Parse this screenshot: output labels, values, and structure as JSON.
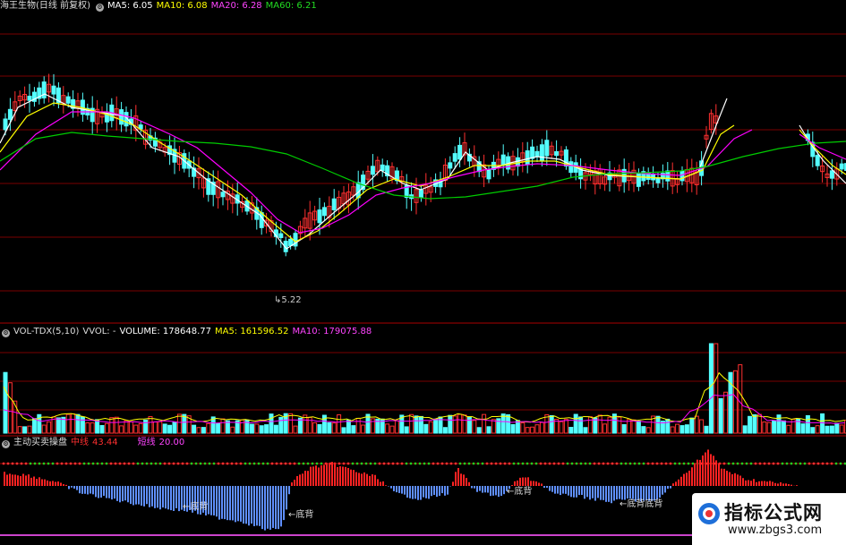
{
  "price_panel": {
    "name": "海王生物(日线 前复权)",
    "ma5": "MA5: 6.05",
    "ma10": "MA10: 6.08",
    "ma20": "MA20: 6.28",
    "ma60": "MA60: 6.21",
    "low_label": "5.22"
  },
  "volume_panel": {
    "indicator": "VOL-TDX(5,10)",
    "vvol": "VVOL: -",
    "volume": "VOLUME: 178648.77",
    "ma5": "MA5: 161596.52",
    "ma10": "MA10: 179075.88"
  },
  "oscillator_panel": {
    "name": "主动买卖操盘",
    "mid_label": "中线",
    "mid_value": "43.44",
    "short_label": "短线",
    "short_value": "20.00",
    "annotations": [
      "底背",
      "底背",
      "底背",
      "底背底背"
    ]
  },
  "watermark": {
    "title": "指标公式网",
    "url": "www.zbgs3.com"
  },
  "colors": {
    "up": "#ff3030",
    "down": "#54ffff",
    "ma5": "#ffffff",
    "ma10": "#ffff00",
    "ma20": "#ff00ff",
    "ma60": "#00cc00",
    "osc_up": "#ff2222",
    "osc_down": "#5f8fff",
    "grid": "#7a0000"
  }
}
